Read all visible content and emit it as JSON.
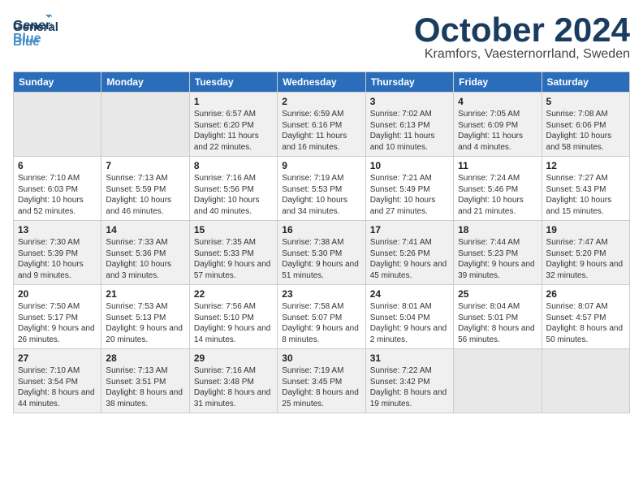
{
  "header": {
    "logo_general": "General",
    "logo_blue": "Blue",
    "month": "October 2024",
    "location": "Kramfors, Vaesternorrland, Sweden"
  },
  "days": [
    "Sunday",
    "Monday",
    "Tuesday",
    "Wednesday",
    "Thursday",
    "Friday",
    "Saturday"
  ],
  "weeks": [
    [
      {
        "date": "",
        "sunrise": "",
        "sunset": "",
        "daylight": "",
        "empty": true
      },
      {
        "date": "",
        "sunrise": "",
        "sunset": "",
        "daylight": "",
        "empty": true
      },
      {
        "date": "1",
        "sunrise": "Sunrise: 6:57 AM",
        "sunset": "Sunset: 6:20 PM",
        "daylight": "Daylight: 11 hours and 22 minutes."
      },
      {
        "date": "2",
        "sunrise": "Sunrise: 6:59 AM",
        "sunset": "Sunset: 6:16 PM",
        "daylight": "Daylight: 11 hours and 16 minutes."
      },
      {
        "date": "3",
        "sunrise": "Sunrise: 7:02 AM",
        "sunset": "Sunset: 6:13 PM",
        "daylight": "Daylight: 11 hours and 10 minutes."
      },
      {
        "date": "4",
        "sunrise": "Sunrise: 7:05 AM",
        "sunset": "Sunset: 6:09 PM",
        "daylight": "Daylight: 11 hours and 4 minutes."
      },
      {
        "date": "5",
        "sunrise": "Sunrise: 7:08 AM",
        "sunset": "Sunset: 6:06 PM",
        "daylight": "Daylight: 10 hours and 58 minutes."
      }
    ],
    [
      {
        "date": "6",
        "sunrise": "Sunrise: 7:10 AM",
        "sunset": "Sunset: 6:03 PM",
        "daylight": "Daylight: 10 hours and 52 minutes."
      },
      {
        "date": "7",
        "sunrise": "Sunrise: 7:13 AM",
        "sunset": "Sunset: 5:59 PM",
        "daylight": "Daylight: 10 hours and 46 minutes."
      },
      {
        "date": "8",
        "sunrise": "Sunrise: 7:16 AM",
        "sunset": "Sunset: 5:56 PM",
        "daylight": "Daylight: 10 hours and 40 minutes."
      },
      {
        "date": "9",
        "sunrise": "Sunrise: 7:19 AM",
        "sunset": "Sunset: 5:53 PM",
        "daylight": "Daylight: 10 hours and 34 minutes."
      },
      {
        "date": "10",
        "sunrise": "Sunrise: 7:21 AM",
        "sunset": "Sunset: 5:49 PM",
        "daylight": "Daylight: 10 hours and 27 minutes."
      },
      {
        "date": "11",
        "sunrise": "Sunrise: 7:24 AM",
        "sunset": "Sunset: 5:46 PM",
        "daylight": "Daylight: 10 hours and 21 minutes."
      },
      {
        "date": "12",
        "sunrise": "Sunrise: 7:27 AM",
        "sunset": "Sunset: 5:43 PM",
        "daylight": "Daylight: 10 hours and 15 minutes."
      }
    ],
    [
      {
        "date": "13",
        "sunrise": "Sunrise: 7:30 AM",
        "sunset": "Sunset: 5:39 PM",
        "daylight": "Daylight: 10 hours and 9 minutes."
      },
      {
        "date": "14",
        "sunrise": "Sunrise: 7:33 AM",
        "sunset": "Sunset: 5:36 PM",
        "daylight": "Daylight: 10 hours and 3 minutes."
      },
      {
        "date": "15",
        "sunrise": "Sunrise: 7:35 AM",
        "sunset": "Sunset: 5:33 PM",
        "daylight": "Daylight: 9 hours and 57 minutes."
      },
      {
        "date": "16",
        "sunrise": "Sunrise: 7:38 AM",
        "sunset": "Sunset: 5:30 PM",
        "daylight": "Daylight: 9 hours and 51 minutes."
      },
      {
        "date": "17",
        "sunrise": "Sunrise: 7:41 AM",
        "sunset": "Sunset: 5:26 PM",
        "daylight": "Daylight: 9 hours and 45 minutes."
      },
      {
        "date": "18",
        "sunrise": "Sunrise: 7:44 AM",
        "sunset": "Sunset: 5:23 PM",
        "daylight": "Daylight: 9 hours and 39 minutes."
      },
      {
        "date": "19",
        "sunrise": "Sunrise: 7:47 AM",
        "sunset": "Sunset: 5:20 PM",
        "daylight": "Daylight: 9 hours and 32 minutes."
      }
    ],
    [
      {
        "date": "20",
        "sunrise": "Sunrise: 7:50 AM",
        "sunset": "Sunset: 5:17 PM",
        "daylight": "Daylight: 9 hours and 26 minutes."
      },
      {
        "date": "21",
        "sunrise": "Sunrise: 7:53 AM",
        "sunset": "Sunset: 5:13 PM",
        "daylight": "Daylight: 9 hours and 20 minutes."
      },
      {
        "date": "22",
        "sunrise": "Sunrise: 7:56 AM",
        "sunset": "Sunset: 5:10 PM",
        "daylight": "Daylight: 9 hours and 14 minutes."
      },
      {
        "date": "23",
        "sunrise": "Sunrise: 7:58 AM",
        "sunset": "Sunset: 5:07 PM",
        "daylight": "Daylight: 9 hours and 8 minutes."
      },
      {
        "date": "24",
        "sunrise": "Sunrise: 8:01 AM",
        "sunset": "Sunset: 5:04 PM",
        "daylight": "Daylight: 9 hours and 2 minutes."
      },
      {
        "date": "25",
        "sunrise": "Sunrise: 8:04 AM",
        "sunset": "Sunset: 5:01 PM",
        "daylight": "Daylight: 8 hours and 56 minutes."
      },
      {
        "date": "26",
        "sunrise": "Sunrise: 8:07 AM",
        "sunset": "Sunset: 4:57 PM",
        "daylight": "Daylight: 8 hours and 50 minutes."
      }
    ],
    [
      {
        "date": "27",
        "sunrise": "Sunrise: 7:10 AM",
        "sunset": "Sunset: 3:54 PM",
        "daylight": "Daylight: 8 hours and 44 minutes."
      },
      {
        "date": "28",
        "sunrise": "Sunrise: 7:13 AM",
        "sunset": "Sunset: 3:51 PM",
        "daylight": "Daylight: 8 hours and 38 minutes."
      },
      {
        "date": "29",
        "sunrise": "Sunrise: 7:16 AM",
        "sunset": "Sunset: 3:48 PM",
        "daylight": "Daylight: 8 hours and 31 minutes."
      },
      {
        "date": "30",
        "sunrise": "Sunrise: 7:19 AM",
        "sunset": "Sunset: 3:45 PM",
        "daylight": "Daylight: 8 hours and 25 minutes."
      },
      {
        "date": "31",
        "sunrise": "Sunrise: 7:22 AM",
        "sunset": "Sunset: 3:42 PM",
        "daylight": "Daylight: 8 hours and 19 minutes."
      },
      {
        "date": "",
        "sunrise": "",
        "sunset": "",
        "daylight": "",
        "empty": true
      },
      {
        "date": "",
        "sunrise": "",
        "sunset": "",
        "daylight": "",
        "empty": true
      }
    ]
  ]
}
